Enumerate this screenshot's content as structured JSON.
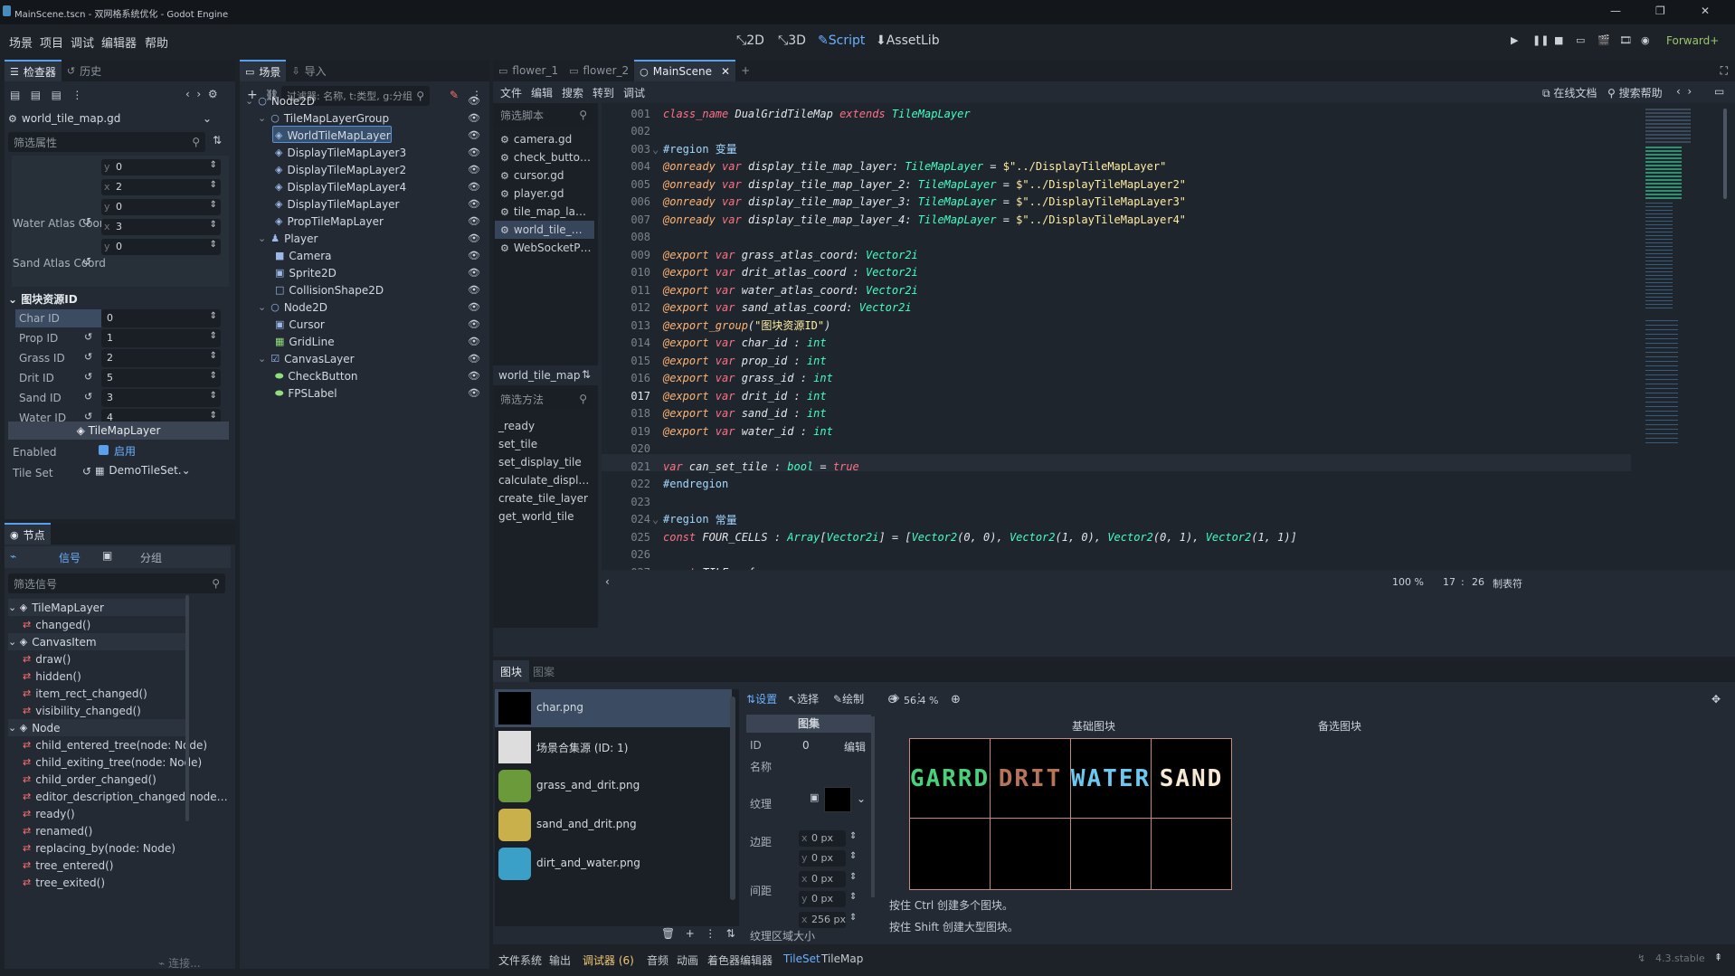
{
  "window": {
    "title": "MainScene.tscn - 双网格系统优化 - Godot Engine",
    "controls": [
      "—",
      "❐",
      "✕"
    ]
  },
  "menu": [
    "场景",
    "项目",
    "调试",
    "编辑器",
    "帮助"
  ],
  "modes": [
    "2D",
    "3D",
    "Script",
    "AssetLib"
  ],
  "renderer": "Forward+",
  "inspector": {
    "tabs": [
      "检查器",
      "历史"
    ],
    "resource": "world_tile_map.gd",
    "filter_placeholder": "筛选属性",
    "water_label": "Water Atlas Coor",
    "sand_label": "Sand Atlas Coord",
    "coord_rows": [
      {
        "axis": "y",
        "val": "0"
      },
      {
        "axis": "x",
        "val": "2"
      },
      {
        "axis": "y",
        "val": "0"
      },
      {
        "axis": "x",
        "val": "3"
      },
      {
        "axis": "y",
        "val": "0"
      }
    ],
    "group": "图块资源ID",
    "ids": [
      {
        "label": "Char ID",
        "val": "0"
      },
      {
        "label": "Prop ID",
        "val": "1"
      },
      {
        "label": "Grass ID",
        "val": "2"
      },
      {
        "label": "Drit ID",
        "val": "5"
      },
      {
        "label": "Sand ID",
        "val": "3"
      },
      {
        "label": "Water ID",
        "val": "4"
      }
    ],
    "section": "TileMapLayer",
    "enabled_label": "Enabled",
    "enabled_val": "启用",
    "tileset_label": "Tile Set",
    "tileset_val": "DemoTileSet."
  },
  "node_panel": {
    "title": "节点",
    "tabs": [
      "信号",
      "分组"
    ],
    "filter": "筛选信号",
    "connect": "连接...",
    "signals": [
      {
        "t": "h",
        "text": "TileMapLayer"
      },
      {
        "t": "s",
        "text": "changed()"
      },
      {
        "t": "h",
        "text": "CanvasItem"
      },
      {
        "t": "s",
        "text": "draw()"
      },
      {
        "t": "s",
        "text": "hidden()"
      },
      {
        "t": "s",
        "text": "item_rect_changed()"
      },
      {
        "t": "s",
        "text": "visibility_changed()"
      },
      {
        "t": "h",
        "text": "Node"
      },
      {
        "t": "s",
        "text": "child_entered_tree(node: Node)"
      },
      {
        "t": "s",
        "text": "child_exiting_tree(node: Node)"
      },
      {
        "t": "s",
        "text": "child_order_changed()"
      },
      {
        "t": "s",
        "text": "editor_description_changed(node…"
      },
      {
        "t": "s",
        "text": "ready()"
      },
      {
        "t": "s",
        "text": "renamed()"
      },
      {
        "t": "s",
        "text": "replacing_by(node: Node)"
      },
      {
        "t": "s",
        "text": "tree_entered()"
      },
      {
        "t": "s",
        "text": "tree_exited()"
      }
    ]
  },
  "scene": {
    "tabs": [
      "场景",
      "导入"
    ],
    "filter_placeholder": "过滤器: 名称, t:类型, g:分组",
    "nodes": [
      {
        "d": 0,
        "text": "Node2D",
        "ico": "○"
      },
      {
        "d": 1,
        "text": "TileMapLayerGroup",
        "ico": "○"
      },
      {
        "d": 2,
        "text": "WorldTileMapLayer",
        "ico": "◈",
        "sel": true
      },
      {
        "d": 2,
        "text": "DisplayTileMapLayer3",
        "ico": "◈"
      },
      {
        "d": 2,
        "text": "DisplayTileMapLayer2",
        "ico": "◈"
      },
      {
        "d": 2,
        "text": "DisplayTileMapLayer4",
        "ico": "◈"
      },
      {
        "d": 2,
        "text": "DisplayTileMapLayer",
        "ico": "◈"
      },
      {
        "d": 2,
        "text": "PropTileMapLayer",
        "ico": "◈"
      },
      {
        "d": 1,
        "text": "Player",
        "ico": "♟"
      },
      {
        "d": 2,
        "text": "Camera",
        "ico": "■"
      },
      {
        "d": 2,
        "text": "Sprite2D",
        "ico": "▣"
      },
      {
        "d": 2,
        "text": "CollisionShape2D",
        "ico": "□"
      },
      {
        "d": 1,
        "text": "Node2D",
        "ico": "○"
      },
      {
        "d": 2,
        "text": "Cursor",
        "ico": "▣"
      },
      {
        "d": 2,
        "text": "GridLine",
        "ico": "▦"
      },
      {
        "d": 1,
        "text": "CanvasLayer",
        "ico": "☑"
      },
      {
        "d": 2,
        "text": "CheckButton",
        "ico": "⬬"
      },
      {
        "d": 2,
        "text": "FPSLabel",
        "ico": "⬬"
      }
    ]
  },
  "editor": {
    "tabs": [
      "flower_1",
      "flower_2",
      "MainScene"
    ],
    "menus": [
      "文件",
      "编辑",
      "搜索",
      "转到",
      "调试"
    ],
    "online_docs": "在线文档",
    "search_help": "搜索帮助",
    "filter_scripts": "筛选脚本",
    "scripts": [
      "camera.gd",
      "check_butto…",
      "cursor.gd",
      "player.gd",
      "tile_map_la…",
      "world_tile_…",
      "WebSocketP…"
    ],
    "current_script": "world_tile_map",
    "filter_methods": "筛选方法",
    "methods": [
      "_ready",
      "set_tile",
      "set_display_tile",
      "calculate_displ…",
      "create_tile_layer",
      "get_world_tile"
    ],
    "zoom": "100 %",
    "line": "17",
    "col": "26",
    "indent": "制表符",
    "code": [
      [
        [
          "kw",
          "class_name "
        ],
        [
          "wh",
          "DualGridTileMap "
        ],
        [
          "kw",
          "extends "
        ],
        [
          "ty",
          "TileMapLayer"
        ]
      ],
      [],
      [
        [
          "rg",
          "#region "
        ],
        [
          "rg",
          "变量"
        ]
      ],
      [
        [
          "an",
          "@onready "
        ],
        [
          "kw",
          "var "
        ],
        [
          "wh",
          "display_tile_map_layer: "
        ],
        [
          "ty",
          "TileMapLayer"
        ],
        [
          "wh",
          " = "
        ],
        [
          "str",
          "$\"../DisplayTileMapLayer\""
        ]
      ],
      [
        [
          "an",
          "@onready "
        ],
        [
          "kw",
          "var "
        ],
        [
          "wh",
          "display_tile_map_layer_2: "
        ],
        [
          "ty",
          "TileMapLayer"
        ],
        [
          "wh",
          " = "
        ],
        [
          "str",
          "$\"../DisplayTileMapLayer2\""
        ]
      ],
      [
        [
          "an",
          "@onready "
        ],
        [
          "kw",
          "var "
        ],
        [
          "wh",
          "display_tile_map_layer_3: "
        ],
        [
          "ty",
          "TileMapLayer"
        ],
        [
          "wh",
          " = "
        ],
        [
          "str",
          "$\"../DisplayTileMapLayer3\""
        ]
      ],
      [
        [
          "an",
          "@onready "
        ],
        [
          "kw",
          "var "
        ],
        [
          "wh",
          "display_tile_map_layer_4: "
        ],
        [
          "ty",
          "TileMapLayer"
        ],
        [
          "wh",
          " = "
        ],
        [
          "str",
          "$\"../DisplayTileMapLayer4\""
        ]
      ],
      [],
      [
        [
          "an",
          "@export "
        ],
        [
          "kw",
          "var "
        ],
        [
          "wh",
          "grass_atlas_coord: "
        ],
        [
          "ty",
          "Vector2i"
        ]
      ],
      [
        [
          "an",
          "@export "
        ],
        [
          "kw",
          "var "
        ],
        [
          "wh",
          "drit_atlas_coord : "
        ],
        [
          "ty",
          "Vector2i"
        ]
      ],
      [
        [
          "an",
          "@export "
        ],
        [
          "kw",
          "var "
        ],
        [
          "wh",
          "water_atlas_coord: "
        ],
        [
          "ty",
          "Vector2i"
        ]
      ],
      [
        [
          "an",
          "@export "
        ],
        [
          "kw",
          "var "
        ],
        [
          "wh",
          "sand_atlas_coord: "
        ],
        [
          "ty",
          "Vector2i"
        ]
      ],
      [
        [
          "an",
          "@export_group"
        ],
        [
          "wh",
          "("
        ],
        [
          "str",
          "\"图块资源ID\""
        ],
        [
          "wh",
          ")"
        ]
      ],
      [
        [
          "an",
          "@export "
        ],
        [
          "kw",
          "var "
        ],
        [
          "wh",
          "char_id : "
        ],
        [
          "ty",
          "int"
        ]
      ],
      [
        [
          "an",
          "@export "
        ],
        [
          "kw",
          "var "
        ],
        [
          "wh",
          "prop_id : "
        ],
        [
          "ty",
          "int"
        ]
      ],
      [
        [
          "an",
          "@export "
        ],
        [
          "kw",
          "var "
        ],
        [
          "wh",
          "grass_id : "
        ],
        [
          "ty",
          "int"
        ]
      ],
      [
        [
          "an",
          "@export "
        ],
        [
          "kw",
          "var "
        ],
        [
          "wh",
          "drit_id : "
        ],
        [
          "ty",
          "int"
        ]
      ],
      [
        [
          "an",
          "@export "
        ],
        [
          "kw",
          "var "
        ],
        [
          "wh",
          "sand_id : "
        ],
        [
          "ty",
          "int"
        ]
      ],
      [
        [
          "an",
          "@export "
        ],
        [
          "kw",
          "var "
        ],
        [
          "wh",
          "water_id : "
        ],
        [
          "ty",
          "int"
        ]
      ],
      [],
      [
        [
          "kw",
          "var "
        ],
        [
          "wh",
          "can_set_tile : "
        ],
        [
          "ty",
          "bool"
        ],
        [
          "wh",
          " = "
        ],
        [
          "kw",
          "true"
        ]
      ],
      [
        [
          "rg",
          "#endregion"
        ]
      ],
      [],
      [
        [
          "rg",
          "#region "
        ],
        [
          "rg",
          "常量"
        ]
      ],
      [
        [
          "kw",
          "const "
        ],
        [
          "wh",
          "FOUR_CELLS : "
        ],
        [
          "ty",
          "Array"
        ],
        [
          "wh",
          "["
        ],
        [
          "ty",
          "Vector2i"
        ],
        [
          "wh",
          "] = ["
        ],
        [
          "ty",
          "Vector2"
        ],
        [
          "wh",
          "(0, 0), "
        ],
        [
          "ty",
          "Vector2"
        ],
        [
          "wh",
          "(1, 0), "
        ],
        [
          "ty",
          "Vector2"
        ],
        [
          "wh",
          "(0, 1), "
        ],
        [
          "ty",
          "Vector2"
        ],
        [
          "wh",
          "(1, 1)]"
        ]
      ],
      [],
      [
        [
          "kw",
          "const "
        ],
        [
          "wh",
          "TILE = {"
        ]
      ],
      [
        [
          "wh",
          "    "
        ],
        [
          "ty",
          "Vector2i"
        ],
        [
          "wh",
          "(2, 1) : [TileType.NotNull, TileType.NotNull, TileType.NotNull, TileType.NotNull], "
        ],
        [
          "cm",
          "# 草"
        ]
      ],
      [
        [
          "wh",
          "    "
        ],
        [
          "ty",
          "Vector2i"
        ],
        [
          "wh",
          "(1, 3) : [TileType.Null, TileType.Null, TileType.Null, TileType.NotNull], "
        ],
        [
          "cm",
          "# 右下角草"
        ]
      ],
      [
        [
          "wh",
          "    "
        ],
        [
          "ty",
          "Vector2i"
        ],
        [
          "wh",
          "(0, 0) : [TileType.Null, TileType.Null, TileType.NotNull, TileType.Null], "
        ],
        [
          "cm",
          "# 左下角草"
        ]
      ]
    ]
  },
  "tileset": {
    "tabs": [
      "图块",
      "图案"
    ],
    "sources": [
      "char.png",
      "场景合集源 (ID: 1)",
      "grass_and_drit.png",
      "sand_and_drit.png",
      "dirt_and_water.png"
    ],
    "tool_tabs": [
      "设置",
      "选择",
      "绘制"
    ],
    "atlas_header": "图集",
    "id_label": "ID",
    "id_val": "0",
    "edit": "编辑",
    "name_label": "名称",
    "texture_label": "纹理",
    "margin_label": "边距",
    "sep_label": "间距",
    "region_label": "纹理区域大小",
    "xy": [
      {
        "a": "x",
        "v": "0 px"
      },
      {
        "a": "y",
        "v": "0 px"
      },
      {
        "a": "x",
        "v": "0 px"
      },
      {
        "a": "y",
        "v": "0 px"
      },
      {
        "a": "x",
        "v": "256 px"
      }
    ],
    "zoom": "56.4 %",
    "base_tiles": "基础图块",
    "alt_tiles": "备选图块",
    "tiles": [
      {
        "text": "GARRD",
        "color": "#4ad07a"
      },
      {
        "text": "DRIT",
        "color": "#b77459"
      },
      {
        "text": "WATER",
        "color": "#6cc8f0"
      },
      {
        "text": "SAND",
        "color": "#f6e8d2"
      }
    ],
    "hint1": "按住 Ctrl 创建多个图块。",
    "hint2": "按住 Shift 创建大型图块。"
  },
  "bottom": {
    "tabs": [
      "文件系统",
      "输出",
      "调试器 (6)",
      "音频",
      "动画",
      "着色器编辑器",
      "TileSet",
      "TileMap"
    ],
    "version": "4.3.stable"
  }
}
